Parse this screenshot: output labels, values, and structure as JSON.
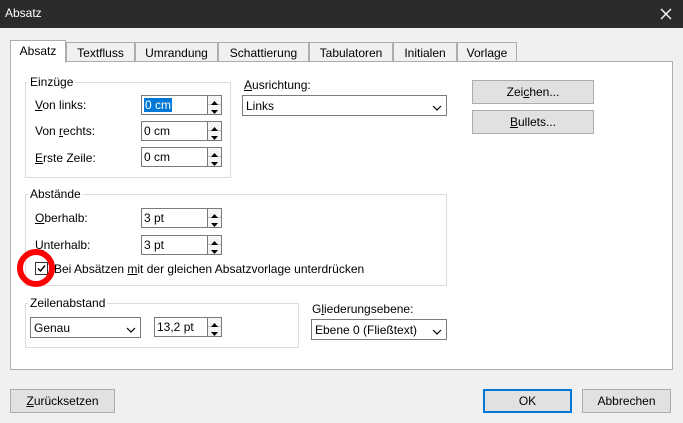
{
  "window": {
    "title": "Absatz"
  },
  "tabs": [
    "Absatz",
    "Textfluss",
    "Umrandung",
    "Schattierung",
    "Tabulatoren",
    "Initialen",
    "Vorlage"
  ],
  "indents": {
    "title": "Einzüge",
    "left_label_u": "V",
    "left_label_rest": "on links:",
    "left_value": "0 cm",
    "right_label_a": "Von ",
    "right_label_u": "r",
    "right_label_b": "echts:",
    "right_value": "0 cm",
    "first_label_u": "E",
    "first_label_rest": "rste Zeile:",
    "first_value": "0 cm"
  },
  "alignment": {
    "label_u": "A",
    "label_rest": "usrichtung:",
    "value": "Links"
  },
  "spacing": {
    "title": "Abstände",
    "above_label_u": "O",
    "above_label_rest": "berhalb:",
    "above_value": "3 pt",
    "below_label_u": "U",
    "below_label_rest": "nterhalb:",
    "below_value": "3 pt",
    "suppress_checkbox": {
      "label_a": "Bei Absätzen ",
      "label_u": "m",
      "label_b": "it der gleichen Absatzvorlage unterdrücken",
      "checked": true
    }
  },
  "line_spacing": {
    "title": "Zeilenabstand",
    "mode": "Genau",
    "value": "13,2 pt"
  },
  "outline": {
    "label_a": "G",
    "label_u": "l",
    "label_b": "iederungsebene:",
    "value": "Ebene 0 (Fließtext)"
  },
  "side_buttons": {
    "chars_a": "Zei",
    "chars_u": "c",
    "chars_b": "hen...",
    "bullets_u": "B",
    "bullets_rest": "ullets..."
  },
  "footer": {
    "reset_u": "Z",
    "reset_rest": "urücksetzen",
    "ok": "OK",
    "cancel": "Abbrechen"
  },
  "colors": {
    "titlebar": "#2b2b2b",
    "selection": "#0078d7",
    "highlight_circle": "#ff0000"
  }
}
